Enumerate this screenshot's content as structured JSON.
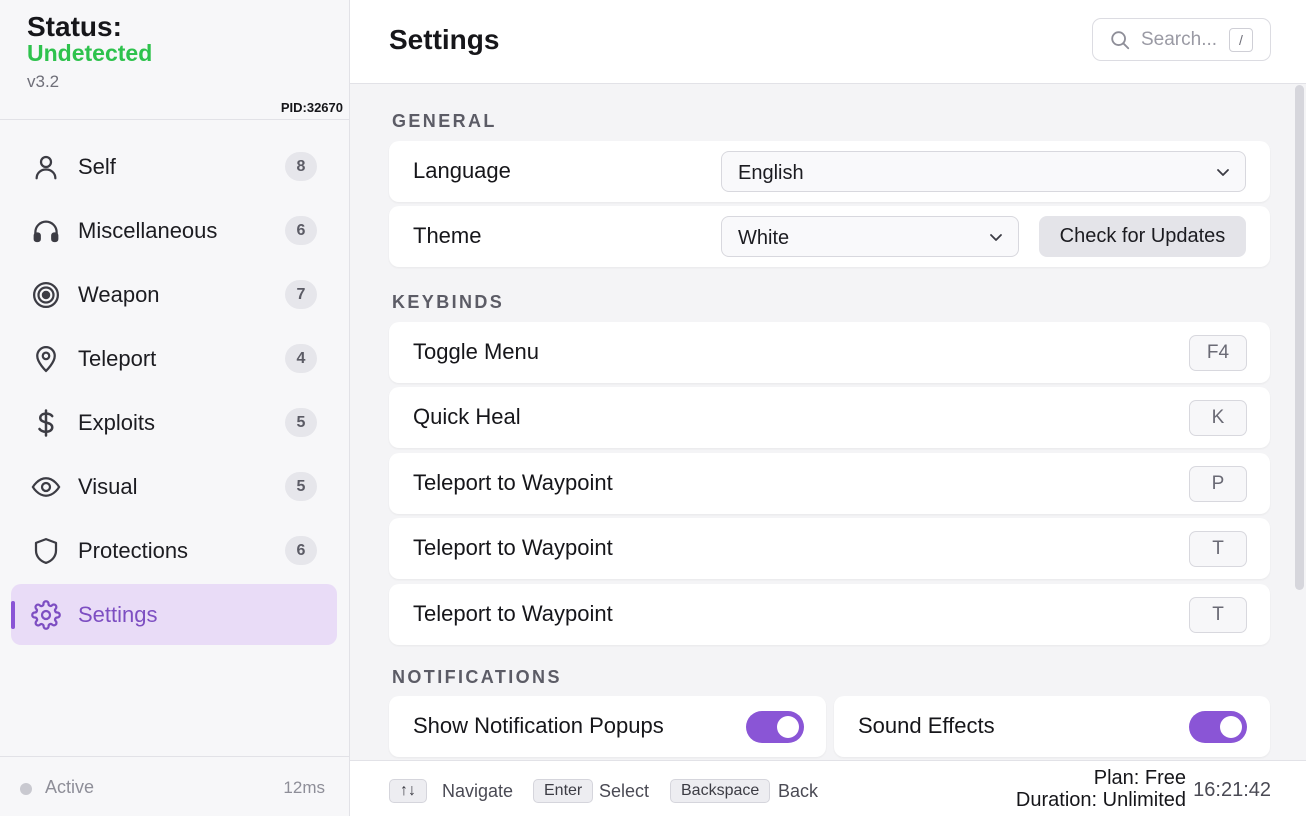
{
  "status": {
    "label": "Status:",
    "value": "Undetected",
    "value_color": "#2ec24d",
    "version": "v3.2",
    "pid": "PID:32670"
  },
  "sidebar": {
    "items": [
      {
        "label": "Self",
        "count": "8",
        "icon": "user-icon"
      },
      {
        "label": "Miscellaneous",
        "count": "6",
        "icon": "headphones-icon"
      },
      {
        "label": "Weapon",
        "count": "7",
        "icon": "target-icon"
      },
      {
        "label": "Teleport",
        "count": "4",
        "icon": "map-pin-icon"
      },
      {
        "label": "Exploits",
        "count": "5",
        "icon": "dollar-icon"
      },
      {
        "label": "Visual",
        "count": "5",
        "icon": "eye-icon"
      },
      {
        "label": "Protections",
        "count": "6",
        "icon": "shield-icon"
      },
      {
        "label": "Settings",
        "icon": "gear-icon",
        "active": true
      }
    ],
    "footer": {
      "status": "Active",
      "ping": "12ms"
    }
  },
  "header": {
    "title": "Settings",
    "search_placeholder": "Search...",
    "search_shortcut": "/"
  },
  "general": {
    "title": "GENERAL",
    "language": {
      "label": "Language",
      "value": "English"
    },
    "theme": {
      "label": "Theme",
      "value": "White"
    },
    "update_button": "Check for Updates"
  },
  "keybinds": {
    "title": "KEYBINDS",
    "items": [
      {
        "label": "Toggle Menu",
        "key": "F4"
      },
      {
        "label": "Quick Heal",
        "key": "K"
      },
      {
        "label": "Teleport to Waypoint",
        "key": "P"
      },
      {
        "label": "Teleport to Waypoint",
        "key": "T"
      },
      {
        "label": "Teleport to Waypoint",
        "key": "T"
      }
    ]
  },
  "notifications": {
    "title": "NOTIFICATIONS",
    "items": [
      {
        "label": "Show Notification Popups",
        "enabled": true
      },
      {
        "label": "Sound Effects",
        "enabled": true
      }
    ]
  },
  "footer": {
    "hints": [
      {
        "key": "↑↓",
        "text": "Navigate"
      },
      {
        "key": "Enter",
        "text": "Select"
      },
      {
        "key": "Backspace",
        "text": "Back"
      }
    ],
    "plan": "Plan: Free",
    "duration": "Duration: Unlimited",
    "time": "16:21:42"
  },
  "colors": {
    "accent": "#8a55d6",
    "active_bg": "#e9dcf7",
    "status_green": "#2ec24d"
  }
}
